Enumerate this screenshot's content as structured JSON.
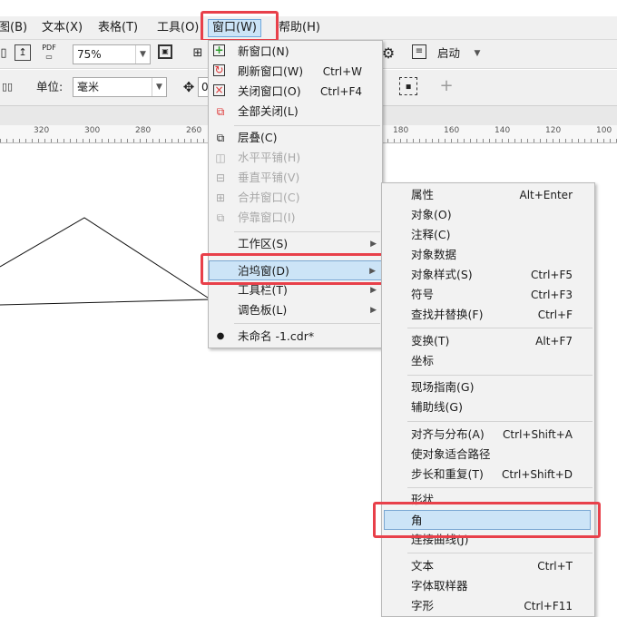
{
  "menubar": {
    "items": [
      {
        "label": "图(B)"
      },
      {
        "label": "文本(X)"
      },
      {
        "label": "表格(T)"
      },
      {
        "label": "工具(O)"
      },
      {
        "label": "窗口(W)"
      },
      {
        "label": "帮助(H)"
      }
    ]
  },
  "toolbar1": {
    "pdf_label": "PDF",
    "zoom_value": "75%",
    "launch_label": "启动"
  },
  "toolbar2": {
    "unit_label": "单位:",
    "unit_value": "毫米",
    "field_partial": "0"
  },
  "ruler": {
    "labels": [
      "320",
      "300",
      "280",
      "260",
      "180",
      "160",
      "140",
      "120",
      "100"
    ]
  },
  "window_menu": {
    "items": [
      {
        "label": "新窗口(N)",
        "shortcut": "",
        "icon": "new-window-icon"
      },
      {
        "label": "刷新窗口(W)",
        "shortcut": "Ctrl+W",
        "icon": "refresh-window-icon"
      },
      {
        "label": "关闭窗口(O)",
        "shortcut": "Ctrl+F4",
        "icon": "close-window-icon"
      },
      {
        "label": "全部关闭(L)",
        "shortcut": "",
        "icon": "close-all-icon"
      },
      {
        "label": "层叠(C)",
        "shortcut": "",
        "icon": "cascade-icon"
      },
      {
        "label": "水平平铺(H)",
        "shortcut": "",
        "icon": "tile-horizontal-icon"
      },
      {
        "label": "垂直平铺(V)",
        "shortcut": "",
        "icon": "tile-vertical-icon"
      },
      {
        "label": "合并窗口(C)",
        "shortcut": "",
        "icon": "combine-window-icon"
      },
      {
        "label": "停靠窗口(I)",
        "shortcut": "",
        "icon": "dock-window-icon"
      },
      {
        "label": "工作区(S)",
        "shortcut": ""
      },
      {
        "label": "泊坞窗(D)",
        "shortcut": ""
      },
      {
        "label": "工具栏(T)",
        "shortcut": ""
      },
      {
        "label": "调色板(L)",
        "shortcut": ""
      },
      {
        "label": "未命名 -1.cdr*",
        "shortcut": ""
      }
    ]
  },
  "docker_menu": {
    "items": [
      {
        "label": "属性",
        "shortcut": "Alt+Enter"
      },
      {
        "label": "对象(O)",
        "shortcut": ""
      },
      {
        "label": "注释(C)",
        "shortcut": ""
      },
      {
        "label": "对象数据",
        "shortcut": ""
      },
      {
        "label": "对象样式(S)",
        "shortcut": "Ctrl+F5"
      },
      {
        "label": "符号",
        "shortcut": "Ctrl+F3"
      },
      {
        "label": "查找并替换(F)",
        "shortcut": "Ctrl+F"
      },
      {
        "label": "变换(T)",
        "shortcut": "Alt+F7"
      },
      {
        "label": "坐标",
        "shortcut": ""
      },
      {
        "label": "现场指南(G)",
        "shortcut": ""
      },
      {
        "label": "辅助线(G)",
        "shortcut": ""
      },
      {
        "label": "对齐与分布(A)",
        "shortcut": "Ctrl+Shift+A"
      },
      {
        "label": "使对象适合路径",
        "shortcut": ""
      },
      {
        "label": "步长和重复(T)",
        "shortcut": "Ctrl+Shift+D"
      },
      {
        "label": "形状",
        "shortcut": ""
      },
      {
        "label": "角",
        "shortcut": ""
      },
      {
        "label": "连接曲线(J)",
        "shortcut": ""
      },
      {
        "label": "文本",
        "shortcut": "Ctrl+T"
      },
      {
        "label": "字体取样器",
        "shortcut": ""
      },
      {
        "label": "字形",
        "shortcut": "Ctrl+F11"
      }
    ]
  },
  "colors": {
    "highlight": "#cce4f7",
    "highlight_border": "#7aa7d3",
    "annotation_red": "#e8404a"
  }
}
